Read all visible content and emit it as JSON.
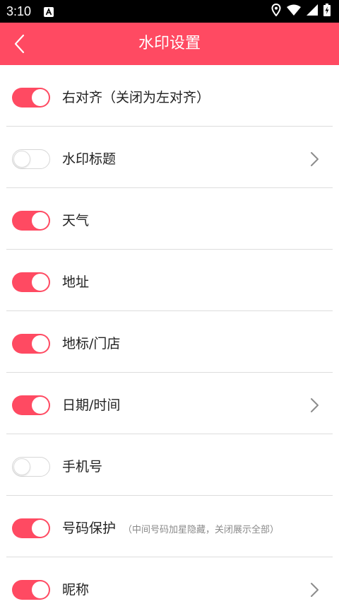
{
  "status_bar": {
    "time": "3:10",
    "icons": [
      "a-notification-icon",
      "location-icon",
      "wifi-icon",
      "signal-icon",
      "battery-charging-icon"
    ]
  },
  "app_bar": {
    "title": "水印设置",
    "background": "#ff4a62"
  },
  "colors": {
    "accent": "#ff4a62",
    "divider": "#dddddd",
    "label": "#222222",
    "note": "#8a8a8a"
  },
  "settings": [
    {
      "label": "右对齐（关闭为左对齐）",
      "note": "",
      "enabled": true,
      "has_chevron": false
    },
    {
      "label": "水印标题",
      "note": "",
      "enabled": false,
      "has_chevron": true
    },
    {
      "label": "天气",
      "note": "",
      "enabled": true,
      "has_chevron": false
    },
    {
      "label": "地址",
      "note": "",
      "enabled": true,
      "has_chevron": false
    },
    {
      "label": "地标/门店",
      "note": "",
      "enabled": true,
      "has_chevron": false
    },
    {
      "label": "日期/时间",
      "note": "",
      "enabled": true,
      "has_chevron": true
    },
    {
      "label": "手机号",
      "note": "",
      "enabled": false,
      "has_chevron": false
    },
    {
      "label": "号码保护",
      "note": "（中间号码加星隐藏，关闭展示全部）",
      "enabled": true,
      "has_chevron": false
    },
    {
      "label": "昵称",
      "note": "",
      "enabled": true,
      "has_chevron": true
    }
  ]
}
